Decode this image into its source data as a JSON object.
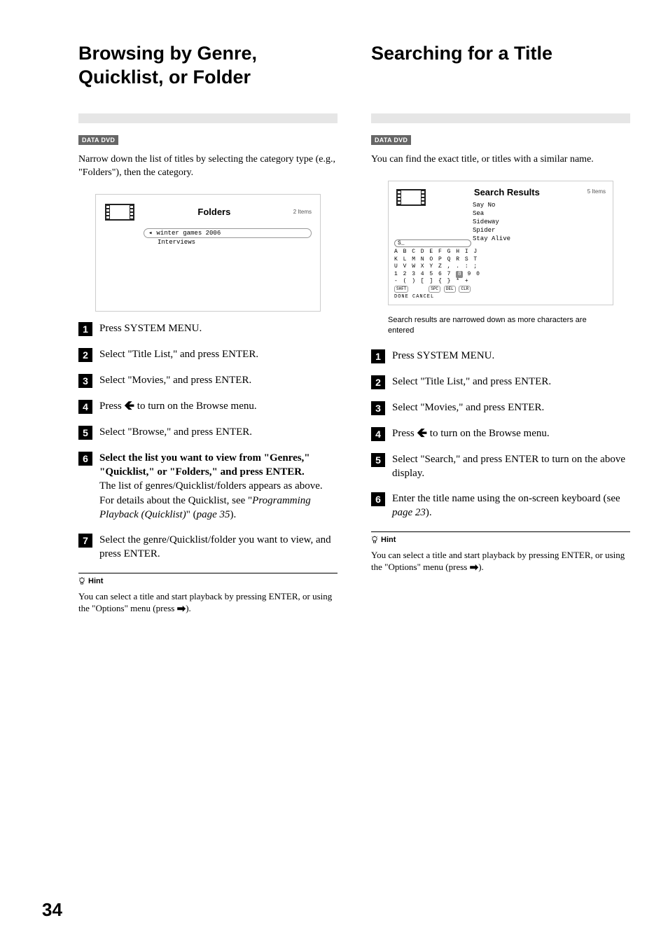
{
  "page_number": "34",
  "left": {
    "title": "Browsing by Genre, Quicklist, or Folder",
    "badge": "DATA DVD",
    "intro": "Narrow down the list of titles by selecting the category type (e.g., \"Folders\"), then the category.",
    "screenshot": {
      "title": "Folders",
      "count": "2 Items",
      "row1": "winter games 2006",
      "row2": "Interviews"
    },
    "steps": {
      "s1": "Press SYSTEM MENU.",
      "s2": "Select \"Title List,\" and press ENTER.",
      "s3": "Select \"Movies,\" and press ENTER.",
      "s4a": "Press ",
      "s4b": " to turn on the Browse menu.",
      "s5": "Select \"Browse,\" and press ENTER.",
      "s6_bold": "Select the list you want to view from \"Genres,\" \"Quicklist,\" or \"Folders,\" and press ENTER.",
      "s6_reg1": "The list of genres/Quicklist/folders appears as above. For details about the Quicklist, see \"",
      "s6_italic": "Programming Playback (Quicklist)",
      "s6_reg2": "\" (",
      "s6_italic2": "page 35",
      "s6_reg3": ").",
      "s7": "Select the genre/Quicklist/folder you want to view, and press ENTER."
    },
    "hint_label": "Hint",
    "hint_text1": "You can select a title and start playback by pressing ENTER, or using the \"Options\" menu (press ",
    "hint_text2": ")."
  },
  "right": {
    "title": "Searching for a Title",
    "badge": "DATA DVD",
    "intro": "You can find the exact title, or titles with a similar name.",
    "screenshot": {
      "title": "Search Results",
      "count": "5 Items",
      "results": [
        "Say No",
        "Sea",
        "Sideway",
        "Spider",
        "Stay Alive"
      ],
      "input": "S_",
      "kb1": "A B C D E F G H I J",
      "kb2": "K L M N O P Q R S T",
      "kb3": "U V W X Y Z , . : ;",
      "kb4a": "1 2 3 4 5 6 7 ",
      "kb4hl": "8",
      "kb4b": " 9 0",
      "kb5": "  - ( ) [ ] { } * +",
      "btn_shft": "SHFT",
      "btn_spc": "SPC",
      "btn_del": "DEL",
      "btn_clr": "CLR",
      "kb_text": "DONE   CANCEL"
    },
    "caption": "Search results are narrowed down as more characters are entered",
    "steps": {
      "s1": "Press SYSTEM MENU.",
      "s2": "Select \"Title List,\" and press ENTER.",
      "s3": "Select \"Movies,\" and press ENTER.",
      "s4a": "Press ",
      "s4b": " to turn on the Browse menu.",
      "s5": "Select \"Search,\" and press ENTER to turn on the above display.",
      "s6a": "Enter the title name using the on-screen keyboard (see ",
      "s6_italic": "page 23",
      "s6b": ")."
    },
    "hint_label": "Hint",
    "hint_text1": "You can select a title and start playback by pressing ENTER, or using the \"Options\" menu (press ",
    "hint_text2": ")."
  }
}
